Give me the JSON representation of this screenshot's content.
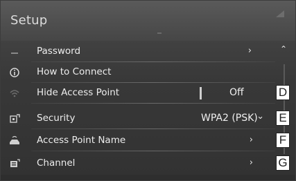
{
  "title": "Setup",
  "rows": [
    {
      "label": "Password",
      "icon": "lock-icon",
      "control": "chevron",
      "glyph": "›"
    },
    {
      "label": "How to Connect",
      "icon": "info-icon",
      "control": "none"
    },
    {
      "label": "Hide Access Point",
      "icon": "wifi-icon",
      "control": "toggle",
      "value": "Off"
    },
    {
      "label": "Security",
      "icon": "security-icon",
      "control": "dropdown",
      "value": "WPA2 (PSK)",
      "glyph": "⌄"
    },
    {
      "label": "Access Point Name",
      "icon": "car-wifi-icon",
      "control": "chevron",
      "glyph": "›"
    },
    {
      "label": "Channel",
      "icon": "channel-icon",
      "control": "chevron",
      "glyph": "›"
    }
  ],
  "scroll": {
    "up_glyph": "⌃"
  },
  "callouts": [
    "D",
    "E",
    "F",
    "G"
  ],
  "colors": {
    "background": "#3a3a3a",
    "text": "#ededed"
  }
}
